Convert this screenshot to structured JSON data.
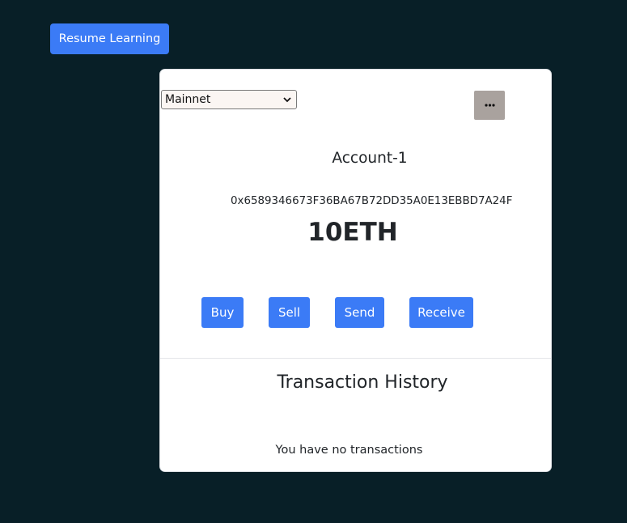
{
  "resume_button": {
    "label": "Resume Learning"
  },
  "wallet": {
    "network": {
      "selected": "Mainnet"
    },
    "menu_icon": "more-horizontal-icon",
    "account_name": "Account-1",
    "address": "0x6589346673F36BA67B72DD35A0E13EBBD7A24F",
    "balance": "10ETH",
    "actions": {
      "buy": "Buy",
      "sell": "Sell",
      "send": "Send",
      "receive": "Receive"
    },
    "transactions": {
      "title": "Transaction History",
      "empty_message": "You have no transactions"
    }
  },
  "colors": {
    "background": "#081f27",
    "primary_button": "#3b7bf6",
    "card": "#ffffff",
    "menu_button": "#a9a29e",
    "text": "#212529"
  }
}
